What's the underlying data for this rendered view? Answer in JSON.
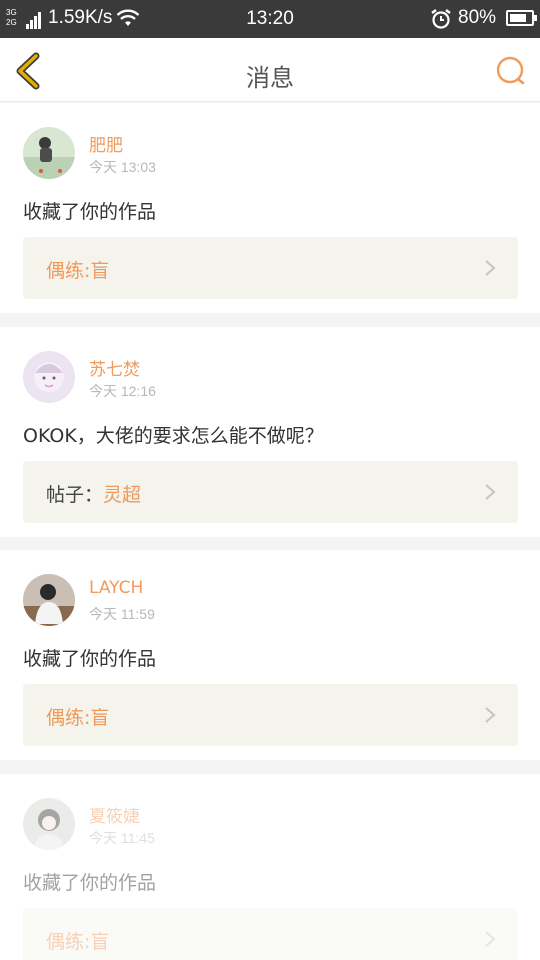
{
  "status_bar": {
    "net_top": "3G",
    "net_bottom": "2G",
    "speed": "1.59K/s",
    "time": "13:20",
    "battery": "80%",
    "battery_level": 0.8
  },
  "nav": {
    "title": "消息"
  },
  "colors": {
    "accent": "#f19a5c",
    "back_icon": "#e2b100",
    "ref_bg": "#f4f4ec"
  },
  "messages": [
    {
      "name": "肥肥",
      "time": "今天 13:03",
      "content": "收藏了你的作品",
      "ref_prefix": "",
      "ref_value": "偶练:盲",
      "avatar_icon": "user-avatar"
    },
    {
      "name": "苏七焚",
      "time": "今天 12:16",
      "content": "OKOK，大佬的要求怎么能不做呢？",
      "ref_prefix": "帖子：",
      "ref_value": "灵超",
      "avatar_icon": "user-avatar"
    },
    {
      "name": "LAYCH",
      "time": "今天 11:59",
      "content": "收藏了你的作品",
      "ref_prefix": "",
      "ref_value": "偶练:盲",
      "avatar_icon": "user-avatar"
    },
    {
      "name": "夏筱婕",
      "time": "今天 11:45",
      "content": "收藏了你的作品",
      "ref_prefix": "",
      "ref_value": "偶练:盲",
      "avatar_icon": "user-avatar"
    }
  ]
}
